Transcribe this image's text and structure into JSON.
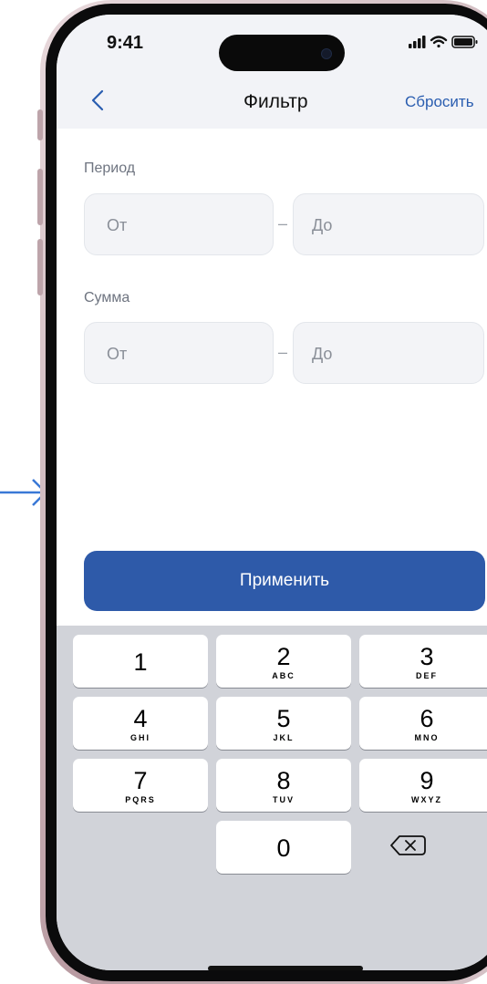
{
  "status": {
    "time": "9:41"
  },
  "nav": {
    "title": "Фильтр",
    "reset_label": "Сбросить"
  },
  "filters": {
    "period": {
      "label": "Период",
      "from_placeholder": "От",
      "separator": "–",
      "to_placeholder": "До"
    },
    "amount": {
      "label": "Сумма",
      "from_placeholder": "От",
      "separator": "–",
      "to_placeholder": "До"
    }
  },
  "apply_label": "Применить",
  "keyboard": {
    "keys": [
      {
        "digit": "1",
        "letters": ""
      },
      {
        "digit": "2",
        "letters": "ABC"
      },
      {
        "digit": "3",
        "letters": "DEF"
      },
      {
        "digit": "4",
        "letters": "GHI"
      },
      {
        "digit": "5",
        "letters": "JKL"
      },
      {
        "digit": "6",
        "letters": "MNO"
      },
      {
        "digit": "7",
        "letters": "PQRS"
      },
      {
        "digit": "8",
        "letters": "TUV"
      },
      {
        "digit": "9",
        "letters": "WXYZ"
      },
      {
        "digit": "0",
        "letters": ""
      }
    ],
    "delete_icon": "backspace-icon"
  },
  "colors": {
    "accent": "#2e5aa9",
    "link": "#2a5db0",
    "arrow": "#3a78d6",
    "field_bg": "#f3f4f7",
    "keyboard_bg": "#d1d3d9"
  }
}
